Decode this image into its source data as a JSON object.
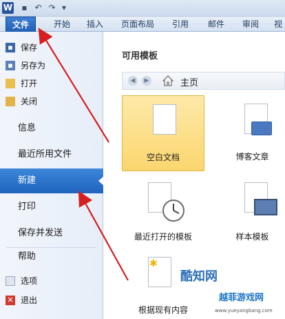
{
  "quick_access": {
    "word_glyph": "W",
    "save_icon": "save-icon",
    "undo_icon": "undo-icon",
    "redo_icon": "redo-icon"
  },
  "tabs": [
    {
      "label": "文件"
    },
    {
      "label": "开始"
    },
    {
      "label": "插入"
    },
    {
      "label": "页面布局"
    },
    {
      "label": "引用"
    },
    {
      "label": "邮件"
    },
    {
      "label": "审阅"
    },
    {
      "label": "视"
    }
  ],
  "backstage_menu": {
    "save": "保存",
    "save_as": "另存为",
    "open": "打开",
    "close": "关闭",
    "info": "信息",
    "recent": "最近所用文件",
    "new": "新建",
    "print": "打印",
    "save_send": "保存并发送",
    "help": "帮助",
    "options": "选项",
    "exit": "退出"
  },
  "templates": {
    "section_title": "可用模板",
    "nav_home": "主页",
    "items": [
      {
        "label": "空白文档"
      },
      {
        "label": "博客文章"
      },
      {
        "label": "最近打开的模板"
      },
      {
        "label": "样本模板"
      },
      {
        "label": "根据现有内容"
      }
    ]
  },
  "watermark": {
    "brand1": "酷知网",
    "brand2": "越菲游戏网",
    "url": "www.yueyangbang.com"
  },
  "colors": {
    "active_blue": "#1f64be",
    "selected_tile": "#fbd66f",
    "arrow_red": "#d42020"
  }
}
